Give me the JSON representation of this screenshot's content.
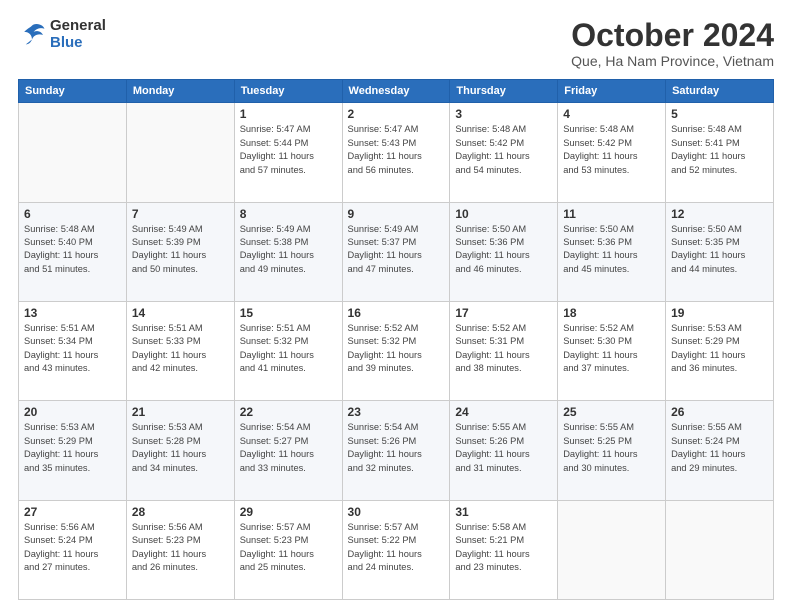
{
  "header": {
    "logo_general": "General",
    "logo_blue": "Blue",
    "title": "October 2024",
    "subtitle": "Que, Ha Nam Province, Vietnam"
  },
  "weekdays": [
    "Sunday",
    "Monday",
    "Tuesday",
    "Wednesday",
    "Thursday",
    "Friday",
    "Saturday"
  ],
  "weeks": [
    [
      {
        "day": "",
        "info": ""
      },
      {
        "day": "",
        "info": ""
      },
      {
        "day": "1",
        "info": "Sunrise: 5:47 AM\nSunset: 5:44 PM\nDaylight: 11 hours\nand 57 minutes."
      },
      {
        "day": "2",
        "info": "Sunrise: 5:47 AM\nSunset: 5:43 PM\nDaylight: 11 hours\nand 56 minutes."
      },
      {
        "day": "3",
        "info": "Sunrise: 5:48 AM\nSunset: 5:42 PM\nDaylight: 11 hours\nand 54 minutes."
      },
      {
        "day": "4",
        "info": "Sunrise: 5:48 AM\nSunset: 5:42 PM\nDaylight: 11 hours\nand 53 minutes."
      },
      {
        "day": "5",
        "info": "Sunrise: 5:48 AM\nSunset: 5:41 PM\nDaylight: 11 hours\nand 52 minutes."
      }
    ],
    [
      {
        "day": "6",
        "info": "Sunrise: 5:48 AM\nSunset: 5:40 PM\nDaylight: 11 hours\nand 51 minutes."
      },
      {
        "day": "7",
        "info": "Sunrise: 5:49 AM\nSunset: 5:39 PM\nDaylight: 11 hours\nand 50 minutes."
      },
      {
        "day": "8",
        "info": "Sunrise: 5:49 AM\nSunset: 5:38 PM\nDaylight: 11 hours\nand 49 minutes."
      },
      {
        "day": "9",
        "info": "Sunrise: 5:49 AM\nSunset: 5:37 PM\nDaylight: 11 hours\nand 47 minutes."
      },
      {
        "day": "10",
        "info": "Sunrise: 5:50 AM\nSunset: 5:36 PM\nDaylight: 11 hours\nand 46 minutes."
      },
      {
        "day": "11",
        "info": "Sunrise: 5:50 AM\nSunset: 5:36 PM\nDaylight: 11 hours\nand 45 minutes."
      },
      {
        "day": "12",
        "info": "Sunrise: 5:50 AM\nSunset: 5:35 PM\nDaylight: 11 hours\nand 44 minutes."
      }
    ],
    [
      {
        "day": "13",
        "info": "Sunrise: 5:51 AM\nSunset: 5:34 PM\nDaylight: 11 hours\nand 43 minutes."
      },
      {
        "day": "14",
        "info": "Sunrise: 5:51 AM\nSunset: 5:33 PM\nDaylight: 11 hours\nand 42 minutes."
      },
      {
        "day": "15",
        "info": "Sunrise: 5:51 AM\nSunset: 5:32 PM\nDaylight: 11 hours\nand 41 minutes."
      },
      {
        "day": "16",
        "info": "Sunrise: 5:52 AM\nSunset: 5:32 PM\nDaylight: 11 hours\nand 39 minutes."
      },
      {
        "day": "17",
        "info": "Sunrise: 5:52 AM\nSunset: 5:31 PM\nDaylight: 11 hours\nand 38 minutes."
      },
      {
        "day": "18",
        "info": "Sunrise: 5:52 AM\nSunset: 5:30 PM\nDaylight: 11 hours\nand 37 minutes."
      },
      {
        "day": "19",
        "info": "Sunrise: 5:53 AM\nSunset: 5:29 PM\nDaylight: 11 hours\nand 36 minutes."
      }
    ],
    [
      {
        "day": "20",
        "info": "Sunrise: 5:53 AM\nSunset: 5:29 PM\nDaylight: 11 hours\nand 35 minutes."
      },
      {
        "day": "21",
        "info": "Sunrise: 5:53 AM\nSunset: 5:28 PM\nDaylight: 11 hours\nand 34 minutes."
      },
      {
        "day": "22",
        "info": "Sunrise: 5:54 AM\nSunset: 5:27 PM\nDaylight: 11 hours\nand 33 minutes."
      },
      {
        "day": "23",
        "info": "Sunrise: 5:54 AM\nSunset: 5:26 PM\nDaylight: 11 hours\nand 32 minutes."
      },
      {
        "day": "24",
        "info": "Sunrise: 5:55 AM\nSunset: 5:26 PM\nDaylight: 11 hours\nand 31 minutes."
      },
      {
        "day": "25",
        "info": "Sunrise: 5:55 AM\nSunset: 5:25 PM\nDaylight: 11 hours\nand 30 minutes."
      },
      {
        "day": "26",
        "info": "Sunrise: 5:55 AM\nSunset: 5:24 PM\nDaylight: 11 hours\nand 29 minutes."
      }
    ],
    [
      {
        "day": "27",
        "info": "Sunrise: 5:56 AM\nSunset: 5:24 PM\nDaylight: 11 hours\nand 27 minutes."
      },
      {
        "day": "28",
        "info": "Sunrise: 5:56 AM\nSunset: 5:23 PM\nDaylight: 11 hours\nand 26 minutes."
      },
      {
        "day": "29",
        "info": "Sunrise: 5:57 AM\nSunset: 5:23 PM\nDaylight: 11 hours\nand 25 minutes."
      },
      {
        "day": "30",
        "info": "Sunrise: 5:57 AM\nSunset: 5:22 PM\nDaylight: 11 hours\nand 24 minutes."
      },
      {
        "day": "31",
        "info": "Sunrise: 5:58 AM\nSunset: 5:21 PM\nDaylight: 11 hours\nand 23 minutes."
      },
      {
        "day": "",
        "info": ""
      },
      {
        "day": "",
        "info": ""
      }
    ]
  ]
}
